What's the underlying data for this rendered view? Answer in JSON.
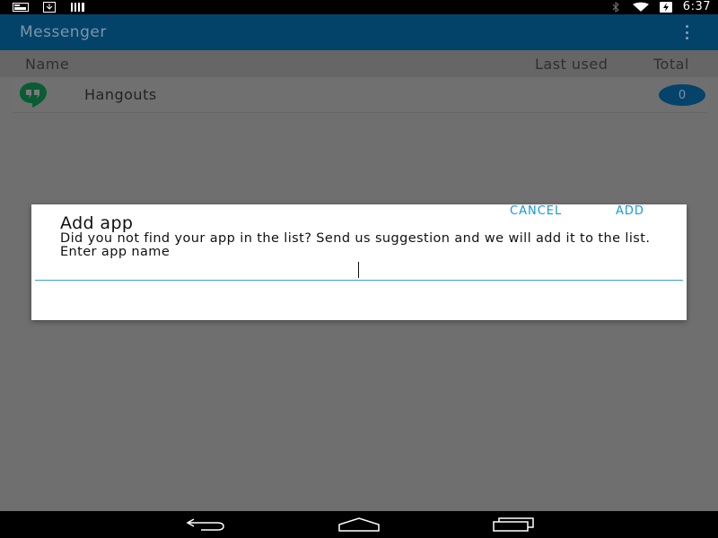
{
  "status_bar": {
    "left_icons": [
      "notification-card-icon",
      "download-icon",
      "barcode-icon"
    ],
    "right_icons": [
      "bluetooth-icon",
      "wifi-icon",
      "battery-charging-icon"
    ],
    "time": "6:37"
  },
  "toolbar": {
    "title": "Messenger",
    "overflow_icon": "overflow-menu-icon"
  },
  "list_header": {
    "name": "Name",
    "last_used": "Last used",
    "total": "Total"
  },
  "apps": [
    {
      "icon": "hangouts-icon",
      "name": "Hangouts",
      "count": "0"
    }
  ],
  "dialog": {
    "title": "Add app",
    "message": "Did you not find your app in the list? Send us suggestion and we will add it to the list. Enter app name",
    "input_value": "",
    "cancel_label": "CANCEL",
    "add_label": "ADD"
  },
  "nav_bar": {
    "icons": [
      "back-icon",
      "home-icon",
      "recents-icon"
    ]
  },
  "colors": {
    "toolbar": "#03436a",
    "accent": "#1598d6",
    "hangouts": "#0f9d58"
  }
}
